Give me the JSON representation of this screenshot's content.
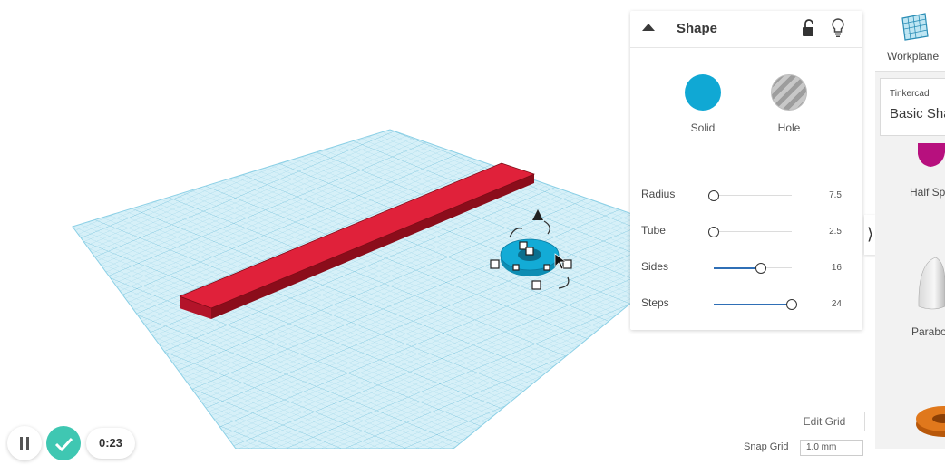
{
  "shape_panel": {
    "title": "Shape",
    "solid_label": "Solid",
    "hole_label": "Hole",
    "solid_color": "#10a8d4",
    "params": [
      {
        "label": "Radius",
        "value": "7.5",
        "fraction": 0.0
      },
      {
        "label": "Tube",
        "value": "2.5",
        "fraction": 0.0
      },
      {
        "label": "Sides",
        "value": "16",
        "fraction": 0.6
      },
      {
        "label": "Steps",
        "value": "24",
        "fraction": 1.0
      }
    ],
    "icons": [
      "chevron-up-icon",
      "lock-icon",
      "lightbulb-icon"
    ]
  },
  "library": {
    "workplane_label": "Workplane",
    "category": "Tinkercad",
    "name": "Basic Sha",
    "shapes": [
      "Half Sp",
      "Parabo"
    ]
  },
  "bottom": {
    "edit_grid": "Edit Grid",
    "snap_grid_label": "Snap Grid",
    "snap_grid_value": "1.0 mm",
    "timer": "0:23"
  },
  "colors": {
    "workplane_grid": "#a8dced",
    "box_red": "#d01a2e",
    "torus_blue": "#10a8d4",
    "accent_check": "#3fc7b2"
  }
}
